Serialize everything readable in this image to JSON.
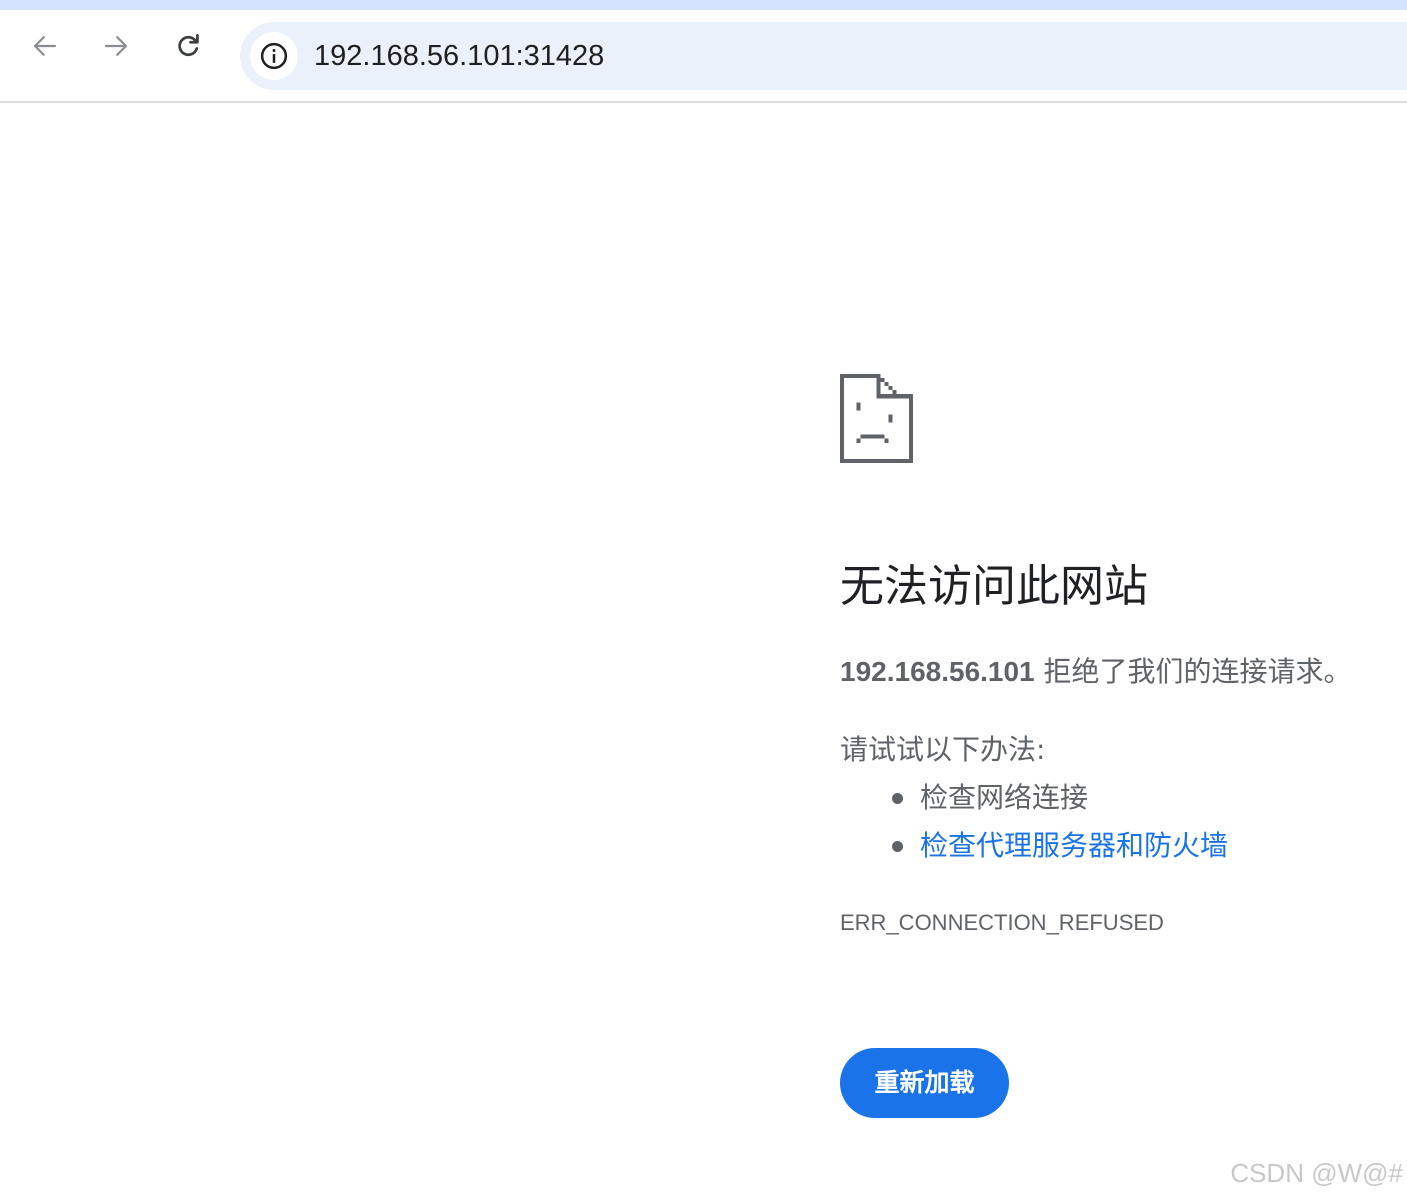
{
  "browser": {
    "back_icon": "arrow-left-icon",
    "forward_icon": "arrow-right-icon",
    "reload_icon": "reload-icon",
    "site_info_icon": "info-icon",
    "url": "192.168.56.101:31428"
  },
  "error_page": {
    "icon": "sad-page-icon",
    "title": "无法访问此网站",
    "summary_host": "192.168.56.101",
    "summary_text": " 拒绝了我们的连接请求。",
    "try_label": "请试试以下办法:",
    "suggestions": [
      {
        "label": "检查网络连接"
      },
      {
        "label": "检查代理服务器和防火墙"
      }
    ],
    "error_code": "ERR_CONNECTION_REFUSED",
    "reload_label": "重新加载"
  },
  "watermark": "CSDN @W@#",
  "colors": {
    "accent": "#1a73e8",
    "text_primary": "#202124",
    "text_secondary": "#5f6368",
    "omnibox_bg": "#eaf1fb"
  }
}
